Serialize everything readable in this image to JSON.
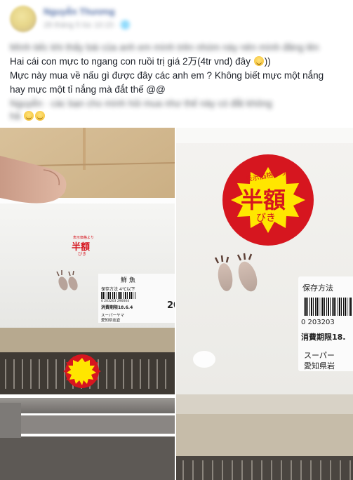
{
  "post": {
    "author_name": "Nguyễn Thương",
    "meta": "28 tháng 5 lúc 10:15 · 🌐",
    "lines": {
      "l1_blur": "Mình tiếc khi thấy bài của anh em mình trên nhóm này nên mình đăng lên",
      "l2": "Hai cái con mực to ngang con ruồi trị giá 2万(4tr vnd) đây",
      "l2_end": "))",
      "l3": "Mực này mua về nấu gì được đây các anh em ? Không biết mực một nắng",
      "l4": "hay mực một tỉ nắng mà đắt thế @@",
      "l5_blur": "Nguyễn · các bạn cho mình hỏi mua như thế này có đắt không",
      "l6_blur": "hả"
    }
  },
  "photos": {
    "left": {
      "sticker_small": "表示価格より",
      "sticker_big": "半額",
      "sticker_hira": "びき",
      "kanji_fish": "鮮 魚",
      "storage": "保存方法",
      "temp": "4℃以下",
      "barcode_num": "0 203203 290004",
      "expiry": "消費期限18.6.4",
      "shop": "スーパーヤマ",
      "addr": "愛知県岩倉",
      "price_edge": "20"
    },
    "right": {
      "sticker_small": "表示価格より",
      "sticker_big": "半額",
      "sticker_hira": "びき",
      "storage": "保存方法",
      "barcode_num": "0  203203",
      "expiry": "消費期限18.",
      "shop": "スーパー",
      "addr": "愛知県岩"
    }
  },
  "colors": {
    "sticker_red": "#d6161f",
    "sticker_yellow": "#ffe600",
    "link_blue": "#385898"
  }
}
